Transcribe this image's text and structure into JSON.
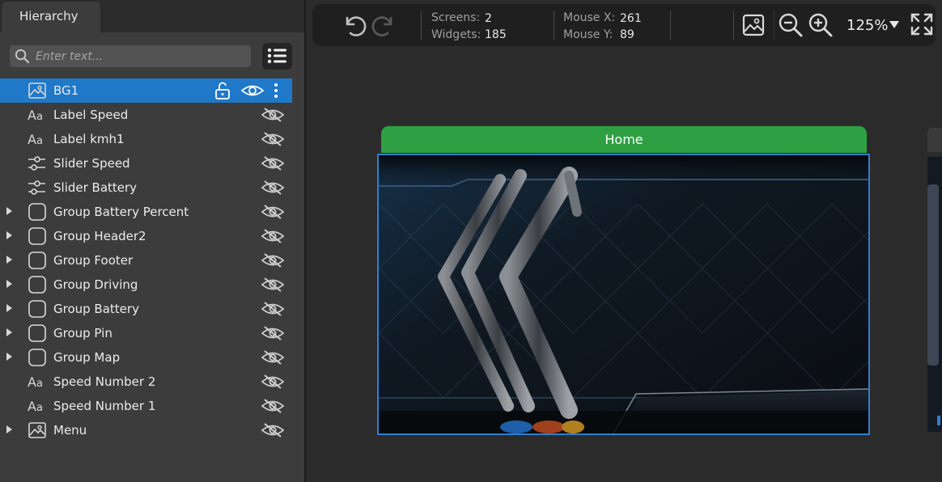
{
  "panel": {
    "tab_label": "Hierarchy",
    "search_placeholder": "Enter text...",
    "search_value": ""
  },
  "tree": [
    {
      "label": "BG1",
      "icon": "image-icon",
      "expandable": false,
      "selected": true
    },
    {
      "label": "Label Speed",
      "icon": "text-icon",
      "expandable": false,
      "selected": false
    },
    {
      "label": "Label kmh1",
      "icon": "text-icon",
      "expandable": false,
      "selected": false
    },
    {
      "label": "Slider Speed",
      "icon": "slider-icon",
      "expandable": false,
      "selected": false
    },
    {
      "label": "Slider Battery",
      "icon": "slider-icon",
      "expandable": false,
      "selected": false
    },
    {
      "label": "Group Battery Percent",
      "icon": "group-icon",
      "expandable": true,
      "selected": false
    },
    {
      "label": "Group Header2",
      "icon": "group-icon",
      "expandable": true,
      "selected": false
    },
    {
      "label": "Group Footer",
      "icon": "group-icon",
      "expandable": true,
      "selected": false
    },
    {
      "label": "Group Driving",
      "icon": "group-icon",
      "expandable": true,
      "selected": false
    },
    {
      "label": "Group Battery",
      "icon": "group-icon",
      "expandable": true,
      "selected": false
    },
    {
      "label": "Group Pin",
      "icon": "group-icon",
      "expandable": true,
      "selected": false
    },
    {
      "label": "Group Map",
      "icon": "group-icon",
      "expandable": true,
      "selected": false
    },
    {
      "label": "Speed Number 2",
      "icon": "text-icon",
      "expandable": false,
      "selected": false
    },
    {
      "label": "Speed Number 1",
      "icon": "text-icon",
      "expandable": false,
      "selected": false
    },
    {
      "label": "Menu",
      "icon": "image-icon",
      "expandable": true,
      "selected": false
    }
  ],
  "toolbar": {
    "screens_label": "Screens:",
    "screens_value": "2",
    "widgets_label": "Widgets:",
    "widgets_value": "185",
    "mousex_label": "Mouse X:",
    "mousex_value": "261",
    "mousey_label": "Mouse Y:",
    "mousey_value": "89",
    "zoom": "125%"
  },
  "canvas": {
    "screen_title": "Home"
  },
  "colors": {
    "selection": "#1f78c8",
    "screen_header": "#2ea043",
    "screen_border": "#2f7fd0"
  }
}
